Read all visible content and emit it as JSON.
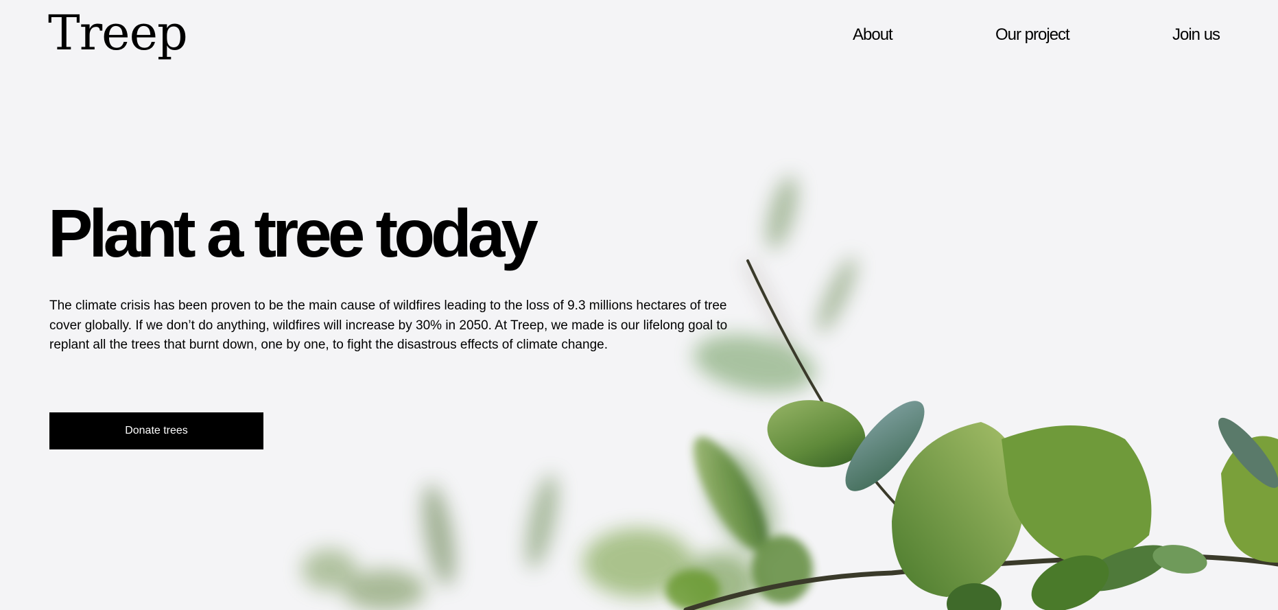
{
  "brand": {
    "logo_text": "Treep"
  },
  "nav": {
    "items": [
      {
        "label": "About"
      },
      {
        "label": "Our project"
      },
      {
        "label": "Join us"
      }
    ]
  },
  "hero": {
    "headline": "Plant a tree today",
    "intro": "The climate crisis has been proven to be the main cause of wildfires leading to the loss of 9.3 millions hectares of tree cover globally. If we don’t do anything, wildfires will increase by 30% in 2050. At Treep, we made is our lifelong goal to replant all the trees that burnt down, one by one, to fight the disastrous effects of climate change.",
    "cta_label": "Donate trees"
  },
  "colors": {
    "background": "#f4f4f6",
    "text": "#000000",
    "button_bg": "#000000",
    "button_text": "#ffffff",
    "leaf_light": "#8aa85a",
    "leaf_dark": "#3f6b2a"
  },
  "imagery": {
    "hero_background": "eucalyptus-branch-image"
  }
}
